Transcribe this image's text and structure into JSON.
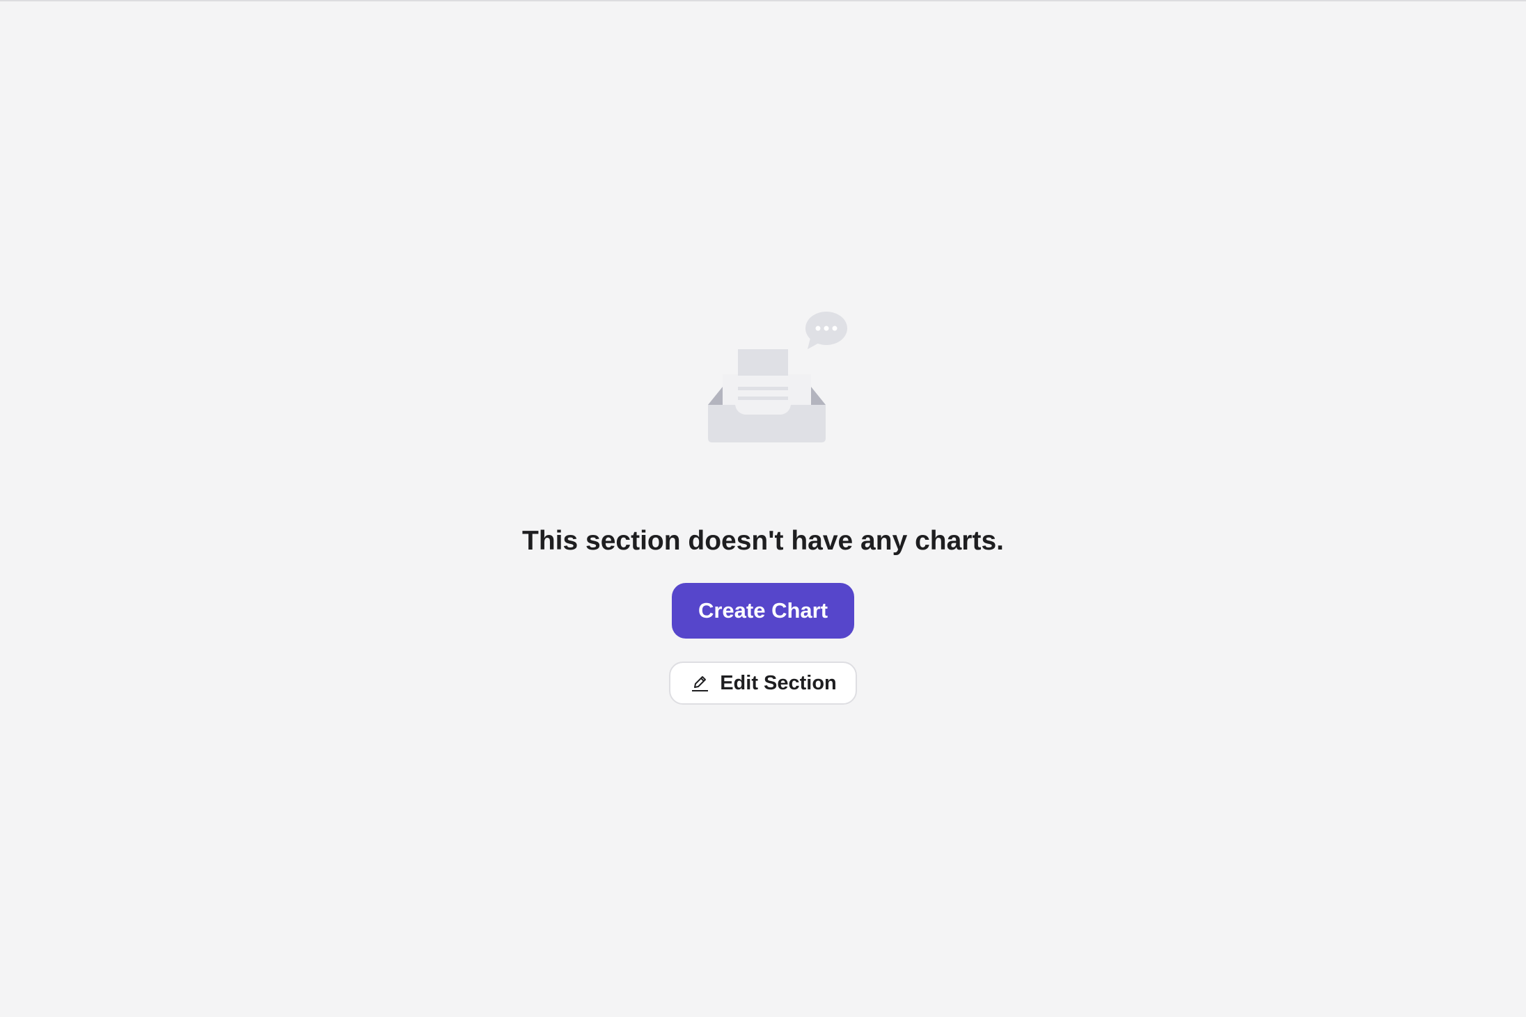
{
  "empty_state": {
    "title": "This section doesn't have any charts.",
    "illustration_icon": "empty-inbox-icon",
    "create_button_label": "Create Chart",
    "edit_button_label": "Edit Section",
    "edit_icon": "pencil-icon"
  },
  "colors": {
    "background": "#f4f4f5",
    "primary": "#5646cb",
    "text": "#1e1e20",
    "illustration_fill": "#dfe0e5",
    "illustration_shade": "#b3b4be"
  }
}
